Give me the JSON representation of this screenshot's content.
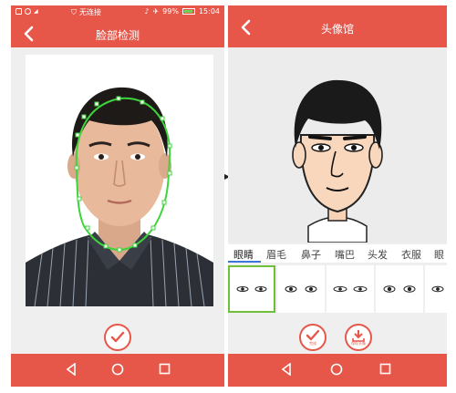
{
  "left_screen": {
    "status": {
      "wifi_label": "无连接",
      "battery_percent": "99%",
      "time": "15:04"
    },
    "appbar": {
      "title": "脸部检测"
    },
    "confirm_icon": "check-icon"
  },
  "right_screen": {
    "appbar": {
      "title": "头像馆"
    },
    "tabs": [
      {
        "label": "眼睛",
        "active": true
      },
      {
        "label": "眉毛",
        "active": false
      },
      {
        "label": "鼻子",
        "active": false
      },
      {
        "label": "嘴巴",
        "active": false
      },
      {
        "label": "头发",
        "active": false
      },
      {
        "label": "衣服",
        "active": false
      },
      {
        "label": "眼",
        "active": false
      }
    ],
    "buttons": {
      "finish_label": "完成",
      "save_label": "保存头像"
    }
  },
  "colors": {
    "accent": "#e6574a",
    "selection": "#6fbf3a",
    "tab_indicator": "#3b78d8",
    "face_outline": "#3ed43b"
  }
}
